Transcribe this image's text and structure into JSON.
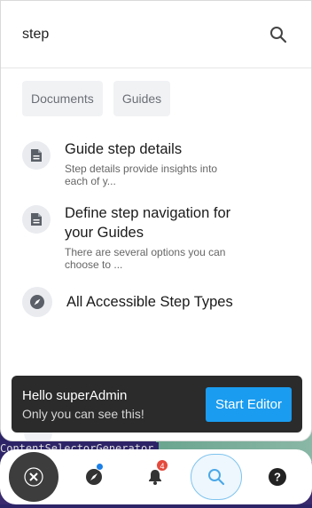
{
  "search": {
    "value": "step",
    "placeholder": ""
  },
  "filters": [
    {
      "label": "Documents"
    },
    {
      "label": "Guides"
    }
  ],
  "results": [
    {
      "icon": "document-icon",
      "title": "Guide step details",
      "description": "Step details provide insights into each of y..."
    },
    {
      "icon": "document-icon",
      "title": "Define step navigation for your Guides",
      "description": "There are several options you can choose to ..."
    },
    {
      "icon": "compass-icon",
      "title": "All Accessible Step Types",
      "description": ""
    }
  ],
  "toast": {
    "title": "Hello superAdmin",
    "subtitle": "Only you can see this!",
    "button_label": "Start Editor"
  },
  "background": {
    "label": "ContentSelectorGenerator"
  },
  "nav": {
    "notifications_count": "4",
    "items": [
      "close-icon",
      "compass-icon",
      "bell-icon",
      "search-icon",
      "help-icon"
    ]
  },
  "colors": {
    "accent": "#1a9cf0",
    "badge": "#e44a3c",
    "toast_bg": "#2b2b2b"
  }
}
